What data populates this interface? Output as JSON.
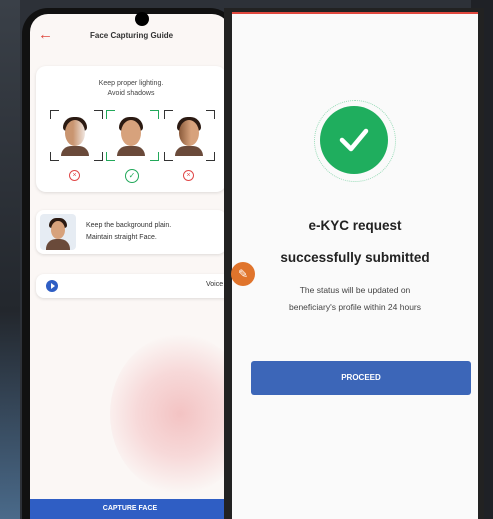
{
  "left_phone": {
    "title": "Face Capturing Guide",
    "tip1_line1": "Keep proper lighting.",
    "tip1_line2": "Avoid shadows",
    "tip2_line1": "Keep the background plain.",
    "tip2_line2": "Maintain straight Face.",
    "voice_label": "Voice",
    "capture_button": "CAPTURE FACE"
  },
  "right_phone": {
    "title_line1": "e-KYC request",
    "title_line2": "successfully submitted",
    "message_line1": "The status will be updated on",
    "message_line2": "beneficiary's profile within 24 hours",
    "proceed_button": "PROCEED"
  },
  "icons": [
    "back-arrow-icon",
    "bad-status-icon",
    "ok-status-icon",
    "play-icon",
    "check-icon",
    "edit-icon"
  ],
  "colors": {
    "accent_blue": "#3c66b8",
    "success_green": "#1fae5e",
    "error_red": "#e04848",
    "edit_orange": "#e0742c"
  }
}
